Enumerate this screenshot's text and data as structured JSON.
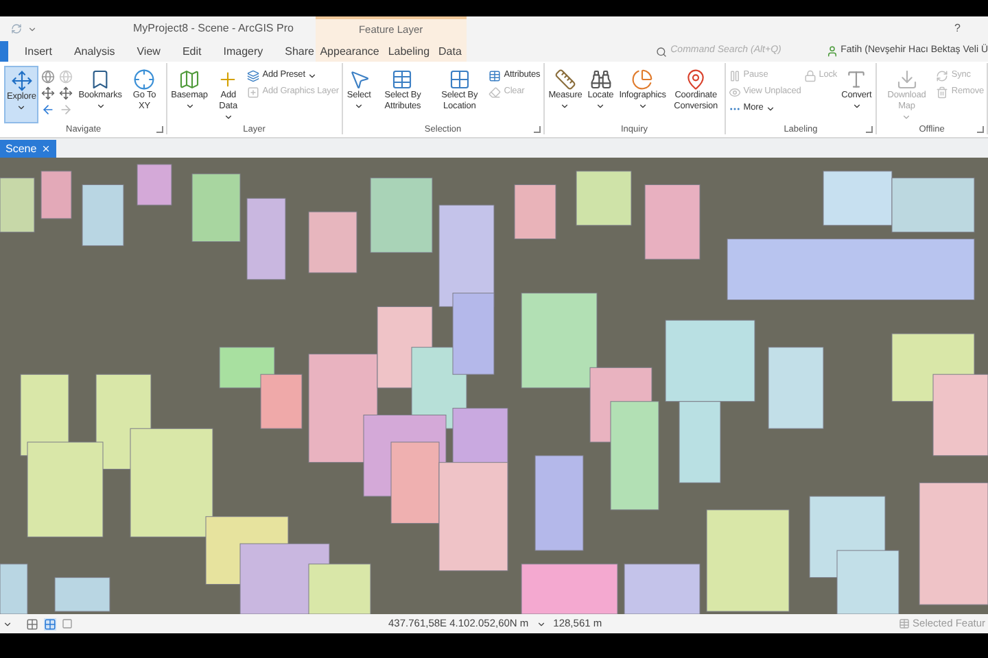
{
  "window": {
    "title": "MyProject8 - Scene - ArcGIS Pro",
    "help": "?"
  },
  "tabs": [
    {
      "label": "Insert",
      "selected": false
    },
    {
      "label": "Analysis",
      "selected": false
    },
    {
      "label": "View",
      "selected": false
    },
    {
      "label": "Edit",
      "selected": false
    },
    {
      "label": "Imagery",
      "selected": false
    },
    {
      "label": "Share",
      "selected": false
    }
  ],
  "contextual": {
    "title": "Feature Layer",
    "tabs": [
      {
        "label": "Appearance",
        "selected": false
      },
      {
        "label": "Labeling",
        "selected": false
      },
      {
        "label": "Data",
        "selected": false
      }
    ]
  },
  "search": {
    "placeholder": "Command Search (Alt+Q)"
  },
  "user": {
    "name": "Fatih (Nevşehir Hacı Bektaş Veli Ü"
  },
  "ribbon": [
    {
      "title": "Navigate",
      "launcher": true,
      "items": [
        {
          "kind": "large",
          "label": "Explore",
          "dropdown": true,
          "selected": true,
          "disabled": false
        },
        {
          "kind": "nav"
        },
        {
          "kind": "large",
          "label": "Bookmarks",
          "dropdown": true,
          "selected": false,
          "disabled": false
        },
        {
          "kind": "large",
          "label": "Go To XY",
          "dropdown": false,
          "selected": false,
          "disabled": false
        }
      ]
    },
    {
      "title": "Layer",
      "launcher": false,
      "items": [
        {
          "kind": "large",
          "label": "Basemap",
          "dropdown": true,
          "selected": false,
          "disabled": false
        },
        {
          "kind": "large",
          "label": "Add Data",
          "dropdown": true,
          "selected": false,
          "disabled": false
        },
        {
          "kind": "small",
          "label": "Add Preset",
          "dropdown": true,
          "disabled": false
        },
        {
          "kind": "small",
          "label": "Add Graphics Layer",
          "dropdown": false,
          "disabled": true
        }
      ]
    },
    {
      "title": "Selection",
      "launcher": true,
      "items": [
        {
          "kind": "large",
          "label": "Select",
          "dropdown": true,
          "selected": false,
          "disabled": false
        },
        {
          "kind": "large",
          "label": "Select By Attributes",
          "dropdown": false,
          "selected": false,
          "disabled": false
        },
        {
          "kind": "large",
          "label": "Select By Location",
          "dropdown": false,
          "selected": false,
          "disabled": false
        },
        {
          "kind": "small",
          "label": "Attributes",
          "dropdown": false,
          "disabled": false
        },
        {
          "kind": "small",
          "label": "Clear",
          "dropdown": false,
          "disabled": true
        }
      ]
    },
    {
      "title": "Inquiry",
      "launcher": false,
      "items": [
        {
          "kind": "large",
          "label": "Measure",
          "dropdown": true,
          "selected": false,
          "disabled": false
        },
        {
          "kind": "large",
          "label": "Locate",
          "dropdown": true,
          "selected": false,
          "disabled": false
        },
        {
          "kind": "large",
          "label": "Infographics",
          "dropdown": true,
          "selected": false,
          "disabled": false
        },
        {
          "kind": "large",
          "label": "Coordinate Conversion",
          "dropdown": false,
          "selected": false,
          "disabled": false
        }
      ]
    },
    {
      "title": "Labeling",
      "launcher": true,
      "items": [
        {
          "kind": "small",
          "label": "Pause",
          "dropdown": false,
          "disabled": true
        },
        {
          "kind": "small",
          "label": "View Unplaced",
          "dropdown": false,
          "disabled": true
        },
        {
          "kind": "small",
          "label": "More",
          "dropdown": true,
          "disabled": false
        },
        {
          "kind": "small",
          "label": "Lock",
          "dropdown": false,
          "disabled": true
        },
        {
          "kind": "large",
          "label": "Convert",
          "dropdown": true,
          "selected": false,
          "disabled": false
        }
      ]
    },
    {
      "title": "Offline",
      "launcher": true,
      "items": [
        {
          "kind": "large",
          "label": "Download Map",
          "dropdown": true,
          "selected": false,
          "disabled": true
        },
        {
          "kind": "small",
          "label": "Sync",
          "dropdown": false,
          "disabled": true
        },
        {
          "kind": "small",
          "label": "Remove",
          "dropdown": false,
          "disabled": true
        }
      ]
    }
  ],
  "view_tab": {
    "label": "Scene",
    "selected": true
  },
  "status_bar": {
    "coordinates": "437.761,58E 4.102.052,60N m",
    "scale": "128,561 m",
    "selected": "Selected Featur"
  }
}
